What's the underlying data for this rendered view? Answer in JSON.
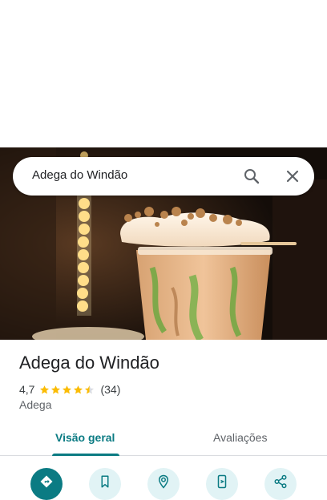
{
  "search": {
    "query": "Adega do Windão"
  },
  "place": {
    "name": "Adega do Windão",
    "rating": "4,7",
    "review_count": "(34)",
    "category": "Adega",
    "stars_filled": 4.5
  },
  "tabs": [
    {
      "label": "Visão geral",
      "active": true
    },
    {
      "label": "Avaliações",
      "active": false
    }
  ],
  "actions": [
    {
      "icon": "directions-icon"
    },
    {
      "icon": "bookmark-icon"
    },
    {
      "icon": "nearby-icon"
    },
    {
      "icon": "send-to-phone-icon"
    },
    {
      "icon": "share-icon"
    }
  ],
  "colors": {
    "accent": "#0b7b83",
    "star": "#fbbc04",
    "action_bg": "#e1f3f5"
  }
}
